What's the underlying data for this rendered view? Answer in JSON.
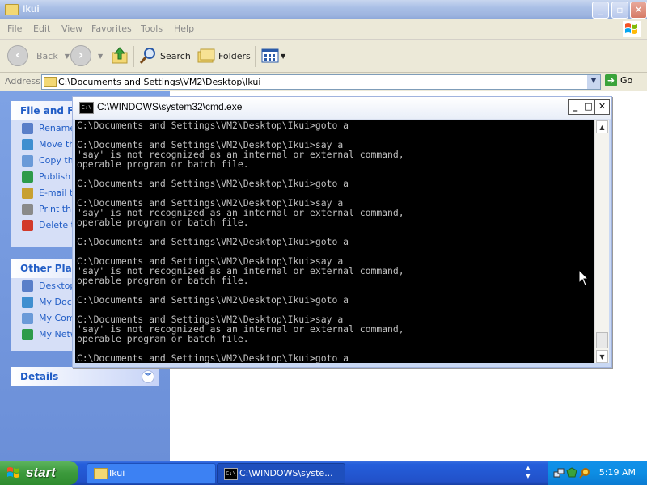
{
  "explorer": {
    "title": "Ikui",
    "menu": [
      "File",
      "Edit",
      "View",
      "Favorites",
      "Tools",
      "Help"
    ],
    "toolbar": {
      "back_label": "Back",
      "search_label": "Search",
      "folders_label": "Folders"
    },
    "address": {
      "label": "Address",
      "value": "C:\\Documents and Settings\\VM2\\Desktop\\Ikui",
      "go_label": "Go"
    },
    "tasks_panel": {
      "title": "File and Fol",
      "items": [
        {
          "label": "Rename",
          "icon": "rename-icon"
        },
        {
          "label": "Move th",
          "icon": "move-icon"
        },
        {
          "label": "Copy thi",
          "icon": "copy-icon"
        },
        {
          "label": "Publish t",
          "icon": "publish-icon"
        },
        {
          "label": "E-mail th",
          "icon": "email-icon"
        },
        {
          "label": "Print this",
          "icon": "print-icon"
        },
        {
          "label": "Delete th",
          "icon": "delete-icon"
        }
      ]
    },
    "places_panel": {
      "title": "Other Place",
      "items": [
        {
          "label": "Desktop",
          "icon": "desktop-icon"
        },
        {
          "label": "My Docu",
          "icon": "my-documents-icon"
        },
        {
          "label": "My Comp",
          "icon": "my-computer-icon"
        },
        {
          "label": "My Netw",
          "icon": "my-network-icon"
        }
      ]
    },
    "details_panel": {
      "title": "Details"
    }
  },
  "cmd": {
    "title": "C:\\WINDOWS\\system32\\cmd.exe",
    "lines": [
      "C:\\Documents and Settings\\VM2\\Desktop\\Ikui>goto a",
      "",
      "C:\\Documents and Settings\\VM2\\Desktop\\Ikui>say a",
      "'say' is not recognized as an internal or external command,",
      "operable program or batch file.",
      "",
      "C:\\Documents and Settings\\VM2\\Desktop\\Ikui>goto a",
      "",
      "C:\\Documents and Settings\\VM2\\Desktop\\Ikui>say a",
      "'say' is not recognized as an internal or external command,",
      "operable program or batch file.",
      "",
      "C:\\Documents and Settings\\VM2\\Desktop\\Ikui>goto a",
      "",
      "C:\\Documents and Settings\\VM2\\Desktop\\Ikui>say a",
      "'say' is not recognized as an internal or external command,",
      "operable program or batch file.",
      "",
      "C:\\Documents and Settings\\VM2\\Desktop\\Ikui>goto a",
      "",
      "C:\\Documents and Settings\\VM2\\Desktop\\Ikui>say a",
      "'say' is not recognized as an internal or external command,",
      "operable program or batch file.",
      "",
      "C:\\Documents and Settings\\VM2\\Desktop\\Ikui>goto a"
    ]
  },
  "taskbar": {
    "start_label": "start",
    "tasks": [
      {
        "label": "Ikui"
      },
      {
        "label": "C:\\WINDOWS\\syste..."
      }
    ],
    "clock": "5:19 AM"
  },
  "colors": {
    "xp_blue": "#245edb",
    "start_green": "#3c9a3c",
    "panel_header": "#215dc6",
    "console_bg": "#000000",
    "console_fg": "#c0c0c0"
  }
}
